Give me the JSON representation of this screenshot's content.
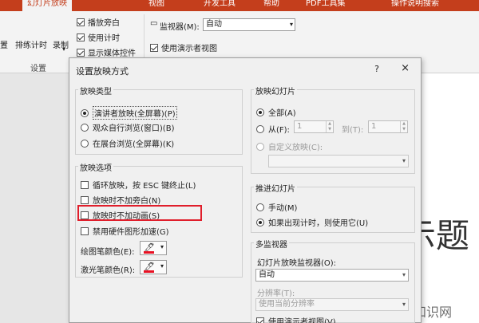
{
  "ribbon": {
    "tabs": [
      "",
      "幻灯片放映",
      "",
      "视图",
      "开发工具",
      "帮助",
      "PDF工具集",
      "操作说明搜索"
    ],
    "btn_rehearse": "排练计时",
    "btn_record": "录制",
    "btn_left_cut": "置",
    "group_setup": "设置",
    "check_play_narration": "播放旁白",
    "check_use_timings": "使用计时",
    "check_show_media": "显示媒体控件",
    "monitor_label": "监视器(M):",
    "monitor_value": "自动",
    "check_presenter_view": "使用演示者视图"
  },
  "slide": {
    "title_fragment": "示题"
  },
  "watermark": "爱创根知识网",
  "dialog": {
    "title": "设置放映方式",
    "help": "?",
    "close": "×",
    "show_type": {
      "legend": "放映类型",
      "opt_presenter": "演讲者放映(全屏幕)(P)",
      "opt_individual": "观众自行浏览(窗口)(B)",
      "opt_kiosk": "在展台浏览(全屏幕)(K)"
    },
    "show_options": {
      "legend": "放映选项",
      "loop": "循环放映，按 ESC 键终止(L)",
      "no_narration": "放映时不加旁白(N)",
      "no_animation": "放映时不加动画(S)",
      "disable_hw": "禁用硬件图形加速(G)",
      "pen_color": "绘图笔颜色(E):",
      "laser_color": "激光笔颜色(R):"
    },
    "show_slides": {
      "legend": "放映幻灯片",
      "all": "全部(A)",
      "from": "从(F):",
      "from_value": "1",
      "to": "到(T):",
      "to_value": "1",
      "custom": "自定义放映(C):"
    },
    "advance": {
      "legend": "推进幻灯片",
      "manual": "手动(M)",
      "timings": "如果出现计时，则使用它(U)"
    },
    "multi": {
      "legend": "多监视器",
      "monitor_label": "幻灯片放映监视器(O):",
      "monitor_value": "自动",
      "resolution_label": "分辨率(T):",
      "resolution_value": "使用当前分辨率",
      "presenter_view": "使用演示者视图(V)"
    }
  },
  "colors": {
    "accent": "#c43e1c",
    "highlight": "#e01e2b",
    "pen": "#e81123"
  }
}
